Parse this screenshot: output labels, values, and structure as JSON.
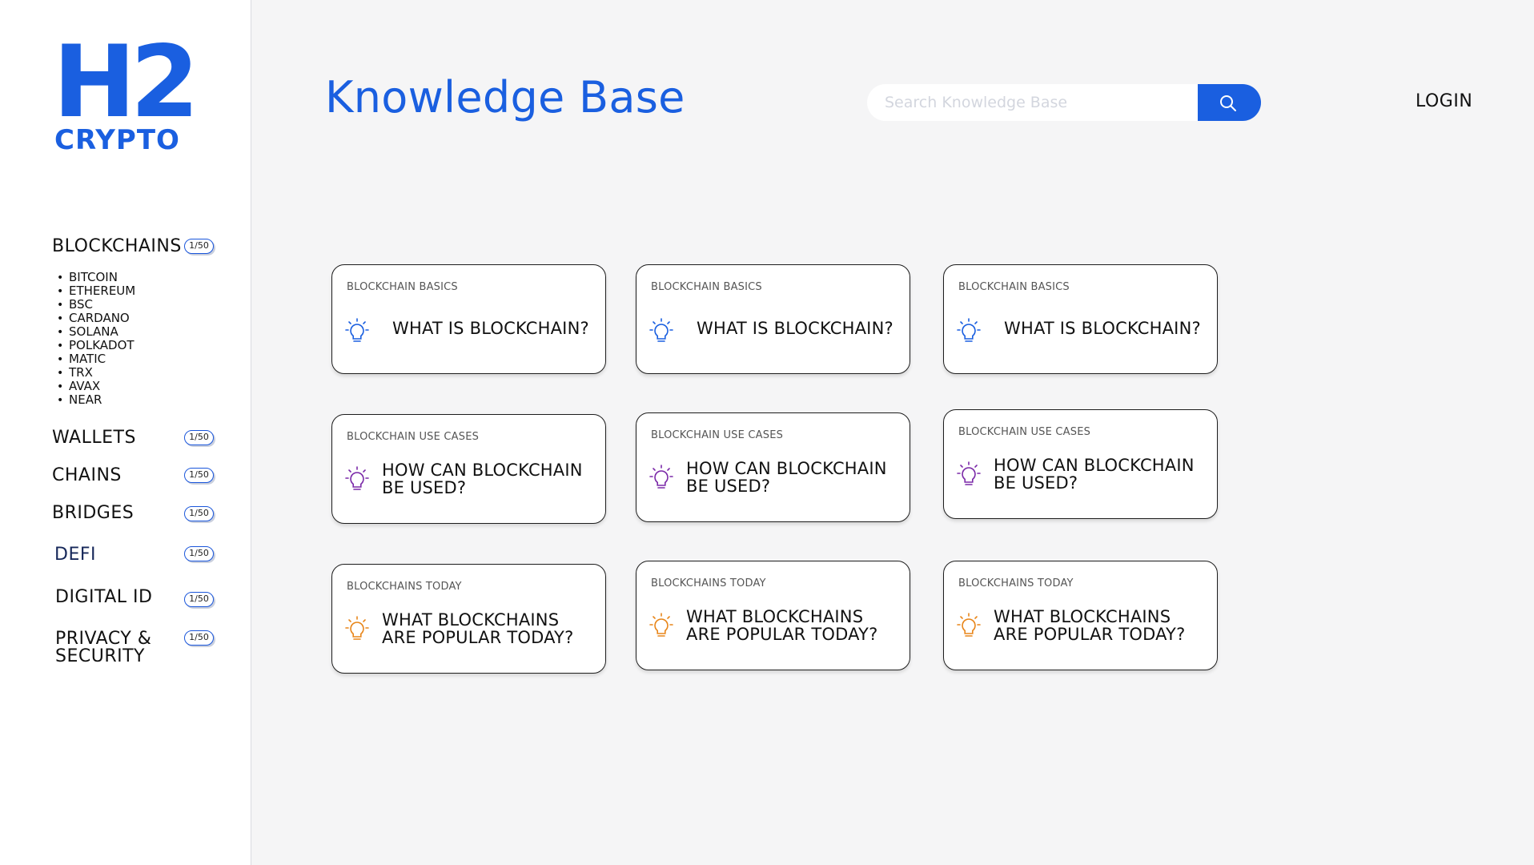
{
  "brand": {
    "main": "H2",
    "sub": "CRYPTO",
    "color": "#1a5fe0"
  },
  "sidebar": {
    "sections": [
      {
        "label": "BLOCKCHAINS",
        "badge": "1/50"
      },
      {
        "label": "WALLETS",
        "badge": "1/50"
      },
      {
        "label": "CHAINS",
        "badge": "1/50"
      },
      {
        "label": "BRIDGES",
        "badge": "1/50"
      },
      {
        "label": "DEFI",
        "badge": "1/50"
      },
      {
        "label": "DIGITAL ID",
        "badge": "1/50"
      },
      {
        "label": "PRIVACY &",
        "label2": "SECURITY",
        "badge": "1/50"
      }
    ],
    "chains": [
      "BITCOIN",
      "ETHEREUM",
      "BSC",
      "CARDANO",
      "SOLANA",
      "POLKADOT",
      "MATIC",
      "TRX",
      "AVAX",
      "NEAR"
    ]
  },
  "header": {
    "title": "Knowledge Base",
    "search_placeholder": "Search Knowledge Base",
    "search_icon": "search-icon",
    "login_label": "LOGIN"
  },
  "cards": [
    {
      "category": "BLOCKCHAIN BASICS",
      "title": "WHAT IS BLOCKCHAIN?",
      "icon": "lightbulb-icon",
      "icon_color": "#1a5fe0"
    },
    {
      "category": "BLOCKCHAIN BASICS",
      "title": "WHAT IS BLOCKCHAIN?",
      "icon": "lightbulb-icon",
      "icon_color": "#1a5fe0"
    },
    {
      "category": "BLOCKCHAIN BASICS",
      "title": "WHAT IS BLOCKCHAIN?",
      "icon": "lightbulb-icon",
      "icon_color": "#1a5fe0"
    },
    {
      "category": "BLOCKCHAIN USE CASES",
      "title": "HOW CAN BLOCKCHAIN",
      "title2": "BE USED?",
      "icon": "lightbulb-icon",
      "icon_color": "#7b2aa8"
    },
    {
      "category": "BLOCKCHAIN USE CASES",
      "title": "HOW CAN BLOCKCHAIN",
      "title2": "BE USED?",
      "icon": "lightbulb-icon",
      "icon_color": "#7b2aa8"
    },
    {
      "category": "BLOCKCHAIN USE CASES",
      "title": "HOW CAN BLOCKCHAIN",
      "title2": "BE USED?",
      "icon": "lightbulb-icon",
      "icon_color": "#7b2aa8"
    },
    {
      "category": "BLOCKCHAINS TODAY",
      "title": "WHAT BLOCKCHAINS",
      "title2": "ARE POPULAR TODAY?",
      "icon": "lightbulb-icon",
      "icon_color": "#e8861a"
    },
    {
      "category": "BLOCKCHAINS TODAY",
      "title": "WHAT BLOCKCHAINS",
      "title2": "ARE POPULAR TODAY?",
      "icon": "lightbulb-icon",
      "icon_color": "#e8861a"
    },
    {
      "category": "BLOCKCHAINS TODAY",
      "title": "WHAT BLOCKCHAINS",
      "title2": "ARE POPULAR TODAY?",
      "icon": "lightbulb-icon",
      "icon_color": "#e8861a"
    }
  ]
}
